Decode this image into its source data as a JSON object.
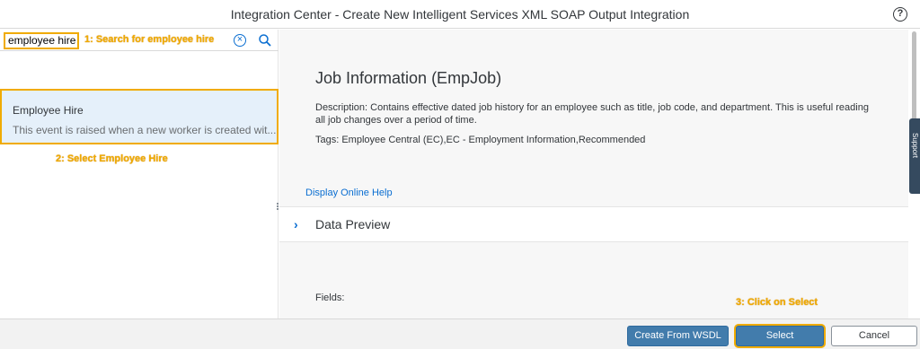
{
  "dialog": {
    "title": "Integration Center - Create New Intelligent Services XML SOAP Output Integration",
    "help_icon": "?"
  },
  "search": {
    "value": "employee hire",
    "clear_icon": "⊗",
    "annotation": "1: Search for employee hire"
  },
  "list": {
    "items": [
      {
        "title": "Employee Hire",
        "description": "This event is raised when a new worker is created wit..."
      }
    ],
    "annotation": "2: Select Employee Hire"
  },
  "detail": {
    "title": "Job Information (EmpJob)",
    "description": "Description: Contains effective dated job history for an employee such as title, job code, and department. This is useful reading all job changes over a period of time.",
    "tags": "Tags: Employee Central (EC),EC - Employment Information,Recommended",
    "help_link": "Display Online Help",
    "data_preview_label": "Data Preview",
    "fields_label": "Fields:"
  },
  "side_tab": {
    "label": "Support"
  },
  "footer": {
    "annotation": "3: Click on Select",
    "create_wsdl_label": "Create From WSDL",
    "select_label": "Select",
    "cancel_label": "Cancel"
  },
  "colors": {
    "accent": "#0a6ed1",
    "highlight": "#f0ab00",
    "button": "#427cac",
    "shell": "#354a5f"
  }
}
